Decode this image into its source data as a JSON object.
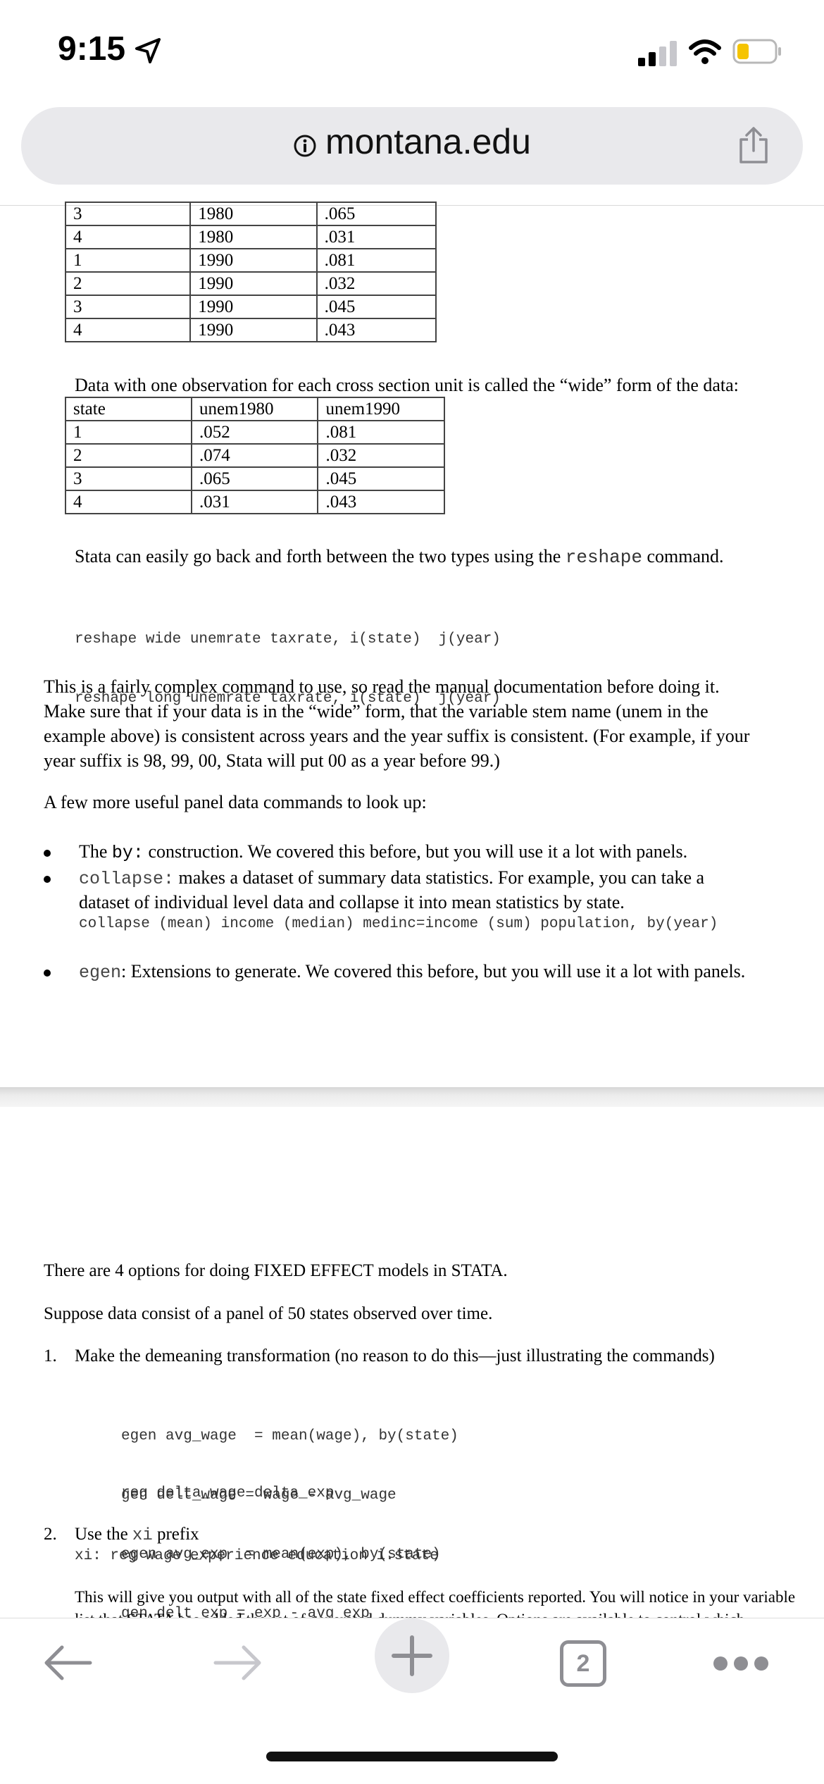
{
  "status": {
    "time": "9:15"
  },
  "browser": {
    "url": "montana.edu",
    "tab_count": "2"
  },
  "long_table_tail": [
    [
      "3",
      "1980",
      ".065"
    ],
    [
      "4",
      "1980",
      ".031"
    ],
    [
      "1",
      "1990",
      ".081"
    ],
    [
      "2",
      "1990",
      ".032"
    ],
    [
      "3",
      "1990",
      ".045"
    ],
    [
      "4",
      "1990",
      ".043"
    ]
  ],
  "wide_intro": "Data with one observation for each cross section unit is called the “wide” form of the data:",
  "wide_table": {
    "headers": [
      "state",
      "unem1980",
      "unem1990"
    ],
    "rows": [
      [
        "1",
        ".052",
        ".081"
      ],
      [
        "2",
        ".074",
        ".032"
      ],
      [
        "3",
        ".065",
        ".045"
      ],
      [
        "4",
        ".031",
        ".043"
      ]
    ]
  },
  "reshape_text": {
    "before": "Stata can easily go back and forth between the two types using the ",
    "cmd": "reshape",
    "after": " command."
  },
  "reshape_code": [
    "reshape wide unemrate taxrate, i(state)  j(year)",
    "reshape long unemrate taxrate, i(state)  j(year)"
  ],
  "complex_para": [
    "This is a fairly complex command to use, so read the manual documentation before doing it.",
    "Make sure that if your data is in the “wide” form, that the variable stem name (unem in the",
    "example above) is consistent across years and the year suffix is consistent.  (For example, if your",
    "year suffix is 98, 99, 00, Stata will put 00 as a year before 99.)"
  ],
  "useful_heading": "A few more useful panel data commands to look up:",
  "bullets": {
    "by_prefix": "The ",
    "by_cmd": "by:",
    "by_text": " construction.  We covered this before, but you will use it a lot with panels.",
    "collapse_cmd": "collapse:",
    "collapse_text": " makes a dataset of summary data statistics.  For example, you can take a",
    "collapse_text2": "dataset of individual level data and collapse it into mean statistics by state.",
    "collapse_code": "collapse (mean) income (median) medinc=income (sum) population, by(year)",
    "egen_cmd": "egen",
    "egen_text": ": Extensions to generate.  We covered this before, but you will use it a lot with panels."
  },
  "fe_heading": "There are 4 options for doing FIXED EFFECT models in STATA.",
  "suppose": "Suppose data consist of a panel of 50 states observed over time.",
  "item1": {
    "num": "1.",
    "text": "Make the demeaning transformation (no reason to do this—just illustrating the commands)",
    "code": [
      "egen avg_wage  = mean(wage), by(state)",
      "gen delt_wage = wage - avg_wage",
      "egen avg_exp  = mean(exp), by(state)",
      "gen delt_exp = exp - avg_exp"
    ],
    "reg": "reg delta_wage delta_exp"
  },
  "item2": {
    "num": "2.",
    "text_before": "Use the ",
    "cmd": "xi",
    "text_after": " prefix",
    "code": "xi: reg wage experience education i.state",
    "output": "This will give you output with all of the state fixed effect coefficients reported.  You will notice in your variable",
    "output2": "list that STATA has added the set of generated dummy variables.  Options are available to control which"
  },
  "colors": {
    "address_bar": "#e9e9ec",
    "text": "#000000",
    "toolbar_icon": "#8e8e93",
    "disabled_icon": "#c7c7cc"
  }
}
